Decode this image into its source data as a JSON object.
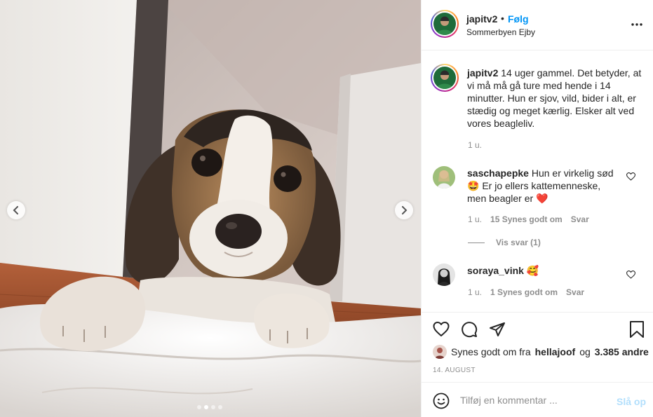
{
  "media": {
    "alt_icons": {
      "prev": "chevron-left-icon",
      "next": "chevron-right-icon"
    },
    "carousel": {
      "count": 4,
      "active_index": 1
    }
  },
  "header": {
    "username": "japitv2",
    "separator": "•",
    "follow_label": "Følg",
    "location": "Sommerbyen Ejby",
    "more_icon": "more-dots-icon"
  },
  "caption": {
    "username": "japitv2",
    "text": "14 uger gammel. Det betyder, at vi må må gå ture med hende i 14 minutter. Hun er sjov, vild, bider i alt, er stædig og meget kærlig. Elsker alt ved vores beagleliv.",
    "time": "1 u."
  },
  "comments": [
    {
      "username": "saschapepke",
      "text_1": "Hun er virkelig sød",
      "emoji_1": "🤩",
      "text_2": "Er jo ellers kattemenneske, men beagler er",
      "emoji_2": "❤️",
      "time": "1 u.",
      "likes": "15 Synes godt om",
      "reply": "Svar",
      "view_replies": "Vis svar (1)"
    },
    {
      "username": "soraya_vink",
      "emoji_1": "🥰",
      "time": "1 u.",
      "likes": "1 Synes godt om",
      "reply": "Svar"
    }
  ],
  "actions": {
    "icons": [
      "heart-icon",
      "comment-icon",
      "share-icon",
      "bookmark-icon"
    ]
  },
  "likes": {
    "prefix": "Synes godt om fra",
    "user": "hellajoof",
    "conj": "og",
    "others": "3.385 andre"
  },
  "date": "14. AUGUST",
  "add_comment": {
    "placeholder": "Tilføj en kommentar ...",
    "post_label": "Slå op"
  },
  "colors": {
    "accent": "#0095f6",
    "post_disabled": "#b2dffc",
    "muted": "#8e8e8e",
    "text": "#262626",
    "divider": "#efefef"
  }
}
